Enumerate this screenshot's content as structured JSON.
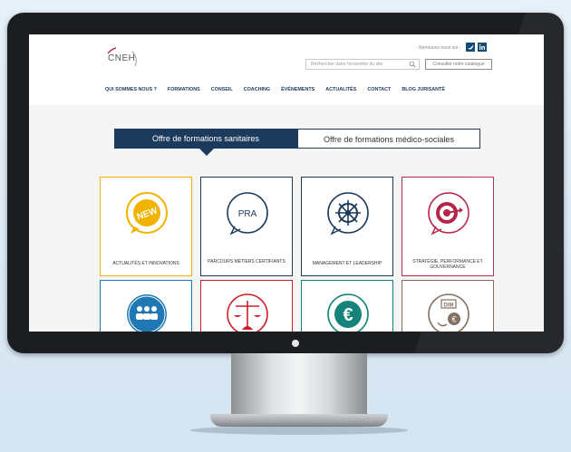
{
  "header": {
    "logo_text": "CNEH",
    "follow_text": "Retrouvez-nous sur :",
    "search_placeholder": "Rechercher dans l'ensemble du site",
    "catalogue_label": "Consulter notre catalogue"
  },
  "nav": {
    "items": [
      "QUI SOMMES NOUS ?",
      "FORMATIONS",
      "CONSEIL",
      "COACHING",
      "ÉVÉNEMENTS",
      "ACTUALITÉS",
      "CONTACT",
      "BLOG JURISANTÉ"
    ]
  },
  "tabs": {
    "active": "Offre de formations sanitaires",
    "inactive": "Offre de formations médico-sociales"
  },
  "cards": [
    {
      "label": "ACTUALITÉS ET INNOVATIONS",
      "icon": "new-badge-icon",
      "color": "#f0b400"
    },
    {
      "label": "PARCOURS MÉTIERS CERTIFIANTS",
      "icon": "praxis-icon",
      "color": "#1c3a5c"
    },
    {
      "label": "MANAGEMENT ET LEADERSHIP",
      "icon": "ship-wheel-icon",
      "color": "#1c3a5c"
    },
    {
      "label": "STRATÉGIE, PERFORMANCE ET GOUVERNANCE",
      "icon": "target-icon",
      "color": "#b5254a"
    },
    {
      "label": "",
      "icon": "people-group-icon",
      "color": "#1e78b4"
    },
    {
      "label": "",
      "icon": "scales-icon",
      "color": "#cc1f27"
    },
    {
      "label": "",
      "icon": "euro-icon",
      "color": "#15837a"
    },
    {
      "label": "",
      "icon": "dim-finance-icon",
      "color": "#7d6b5c"
    }
  ]
}
